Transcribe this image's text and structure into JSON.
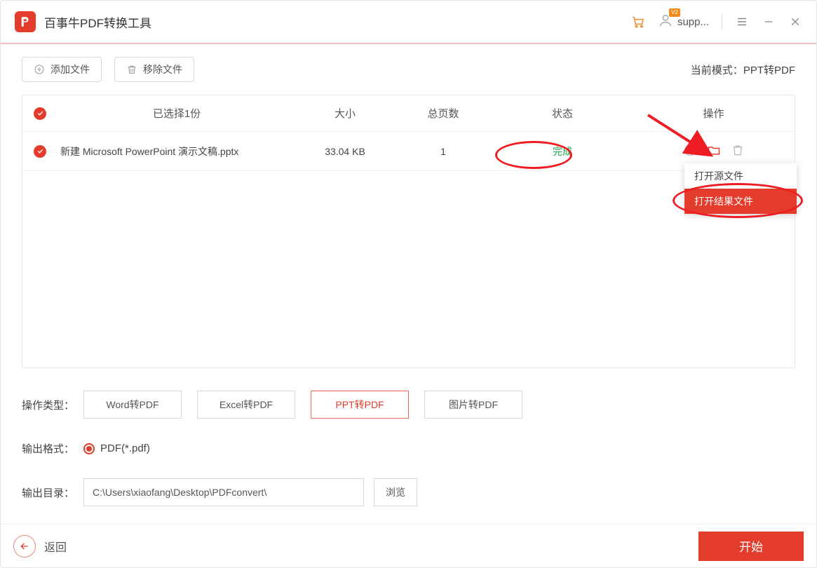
{
  "app": {
    "title": "百事牛PDF转换工具"
  },
  "header": {
    "user_label": "supp...",
    "badge": "V2"
  },
  "toolbar": {
    "add_file": "添加文件",
    "remove_file": "移除文件",
    "mode_prefix": "当前模式：",
    "mode_value": "PPT转PDF"
  },
  "table": {
    "headers": {
      "selected": "已选择1份",
      "size": "大小",
      "pages": "总页数",
      "status": "状态",
      "actions": "操作"
    },
    "rows": [
      {
        "name": "新建 Microsoft PowerPoint 演示文稿.pptx",
        "size": "33.04 KB",
        "pages": "1",
        "status": "完成"
      }
    ]
  },
  "op_type": {
    "label": "操作类型：",
    "options": [
      "Word转PDF",
      "Excel转PDF",
      "PPT转PDF",
      "图片转PDF"
    ],
    "active_index": 2
  },
  "output_format": {
    "label": "输出格式：",
    "value": "PDF(*.pdf)"
  },
  "output_dir": {
    "label": "输出目录：",
    "path": "C:\\Users\\xiaofang\\Desktop\\PDFconvert\\",
    "browse": "浏览"
  },
  "footer": {
    "back": "返回",
    "start": "开始"
  },
  "context_menu": {
    "items": [
      "打开源文件",
      "打开结果文件"
    ],
    "highlight_index": 1
  }
}
